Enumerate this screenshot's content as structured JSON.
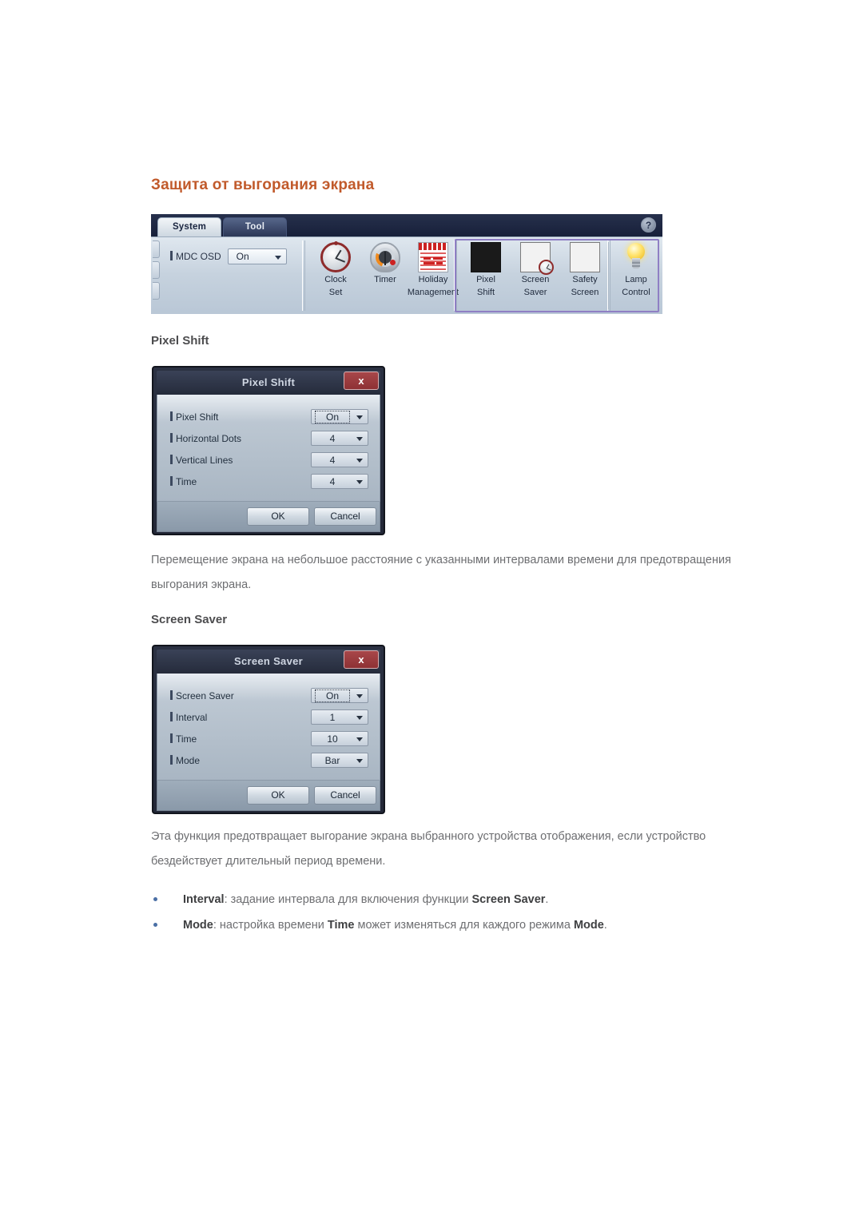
{
  "page": {
    "section_title": "Защита от выгорания экрана"
  },
  "toolbar": {
    "tabs": [
      {
        "label": "System",
        "active": true
      },
      {
        "label": "Tool",
        "active": false
      }
    ],
    "help_label": "?",
    "osd": {
      "label": "MDC OSD",
      "value": "On"
    },
    "buttons": [
      {
        "line1": "Clock",
        "line2": "Set",
        "icon": "clock-icon"
      },
      {
        "line1": "Timer",
        "line2": "",
        "icon": "timer-icon"
      },
      {
        "line1": "Holiday",
        "line2": "Management",
        "icon": "calendar-icon"
      },
      {
        "line1": "Pixel",
        "line2": "Shift",
        "icon": "pixel-shift-tiles-icon"
      },
      {
        "line1": "Screen",
        "line2": "Saver",
        "icon": "screen-saver-tiles-clock-icon"
      },
      {
        "line1": "Safety",
        "line2": "Screen",
        "icon": "safety-screen-tiles-icon"
      },
      {
        "line1": "Lamp",
        "line2": "Control",
        "icon": "lamp-bulb-icon"
      }
    ],
    "selection_color": "#8f7fc4"
  },
  "pixel_shift": {
    "heading": "Pixel Shift",
    "dialog": {
      "title": "Pixel Shift",
      "close_label": "x",
      "rows": [
        {
          "label": "Pixel Shift",
          "value": "On",
          "focused": true
        },
        {
          "label": "Horizontal Dots",
          "value": "4",
          "focused": false
        },
        {
          "label": "Vertical Lines",
          "value": "4",
          "focused": false
        },
        {
          "label": "Time",
          "value": "4",
          "focused": false
        }
      ],
      "ok_label": "OK",
      "cancel_label": "Cancel"
    },
    "paragraph": "Перемещение экрана на небольшое расстояние с указанными интервалами времени для предотвращения выгорания экрана."
  },
  "screen_saver": {
    "heading": "Screen Saver",
    "dialog": {
      "title": "Screen Saver",
      "close_label": "x",
      "rows": [
        {
          "label": "Screen Saver",
          "value": "On",
          "focused": true
        },
        {
          "label": "Interval",
          "value": "1",
          "focused": false
        },
        {
          "label": "Time",
          "value": "10",
          "focused": false
        },
        {
          "label": "Mode",
          "value": "Bar",
          "focused": false
        }
      ],
      "ok_label": "OK",
      "cancel_label": "Cancel"
    },
    "paragraph": "Эта функция предотвращает выгорание экрана выбранного устройства отображения, если устройство бездействует длительный период времени.",
    "bullets": [
      {
        "term": "Interval",
        "text_before": ": задание интервала для включения функции ",
        "term2": "Screen Saver",
        "text_after": "."
      },
      {
        "term": "Mode",
        "text_before": ": настройка времени ",
        "term2": "Time",
        "text_mid": " может изменяться для каждого режима ",
        "term3": "Mode",
        "text_after": "."
      }
    ]
  },
  "colors": {
    "title_orange": "#c15a2b",
    "body_gray": "#6d6e71",
    "selection_purple": "#8f7fc4"
  }
}
